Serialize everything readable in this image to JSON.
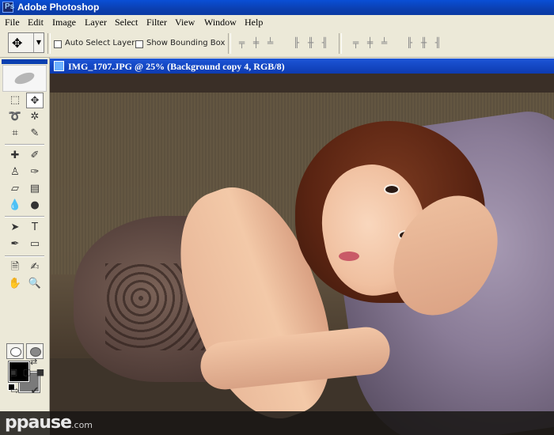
{
  "app": {
    "title": "Adobe Photoshop"
  },
  "menu": [
    "File",
    "Edit",
    "Image",
    "Layer",
    "Select",
    "Filter",
    "View",
    "Window",
    "Help"
  ],
  "options": {
    "auto_select_label": "Auto Select Layer",
    "auto_select_checked": false,
    "bounding_box_label": "Show Bounding Box",
    "bounding_box_checked": false
  },
  "document": {
    "title": "IMG_1707.JPG @ 25% (Background copy 4, RGB/8)"
  },
  "colors": {
    "foreground": "#000000",
    "background": "#7a7a7a",
    "titlebar": "#0a3fb0"
  },
  "watermark": {
    "brand": "ppause",
    "suffix": ".com"
  },
  "tools": [
    "rect-marquee-icon",
    "move-icon",
    "lasso-icon",
    "magic-wand-icon",
    "crop-icon",
    "slice-icon",
    "healing-brush-icon",
    "brush-icon",
    "clone-stamp-icon",
    "history-brush-icon",
    "eraser-icon",
    "gradient-icon",
    "blur-icon",
    "dodge-icon",
    "path-select-icon",
    "type-icon",
    "pen-icon",
    "shape-icon",
    "notes-icon",
    "eyedropper-icon",
    "hand-icon",
    "zoom-icon"
  ]
}
